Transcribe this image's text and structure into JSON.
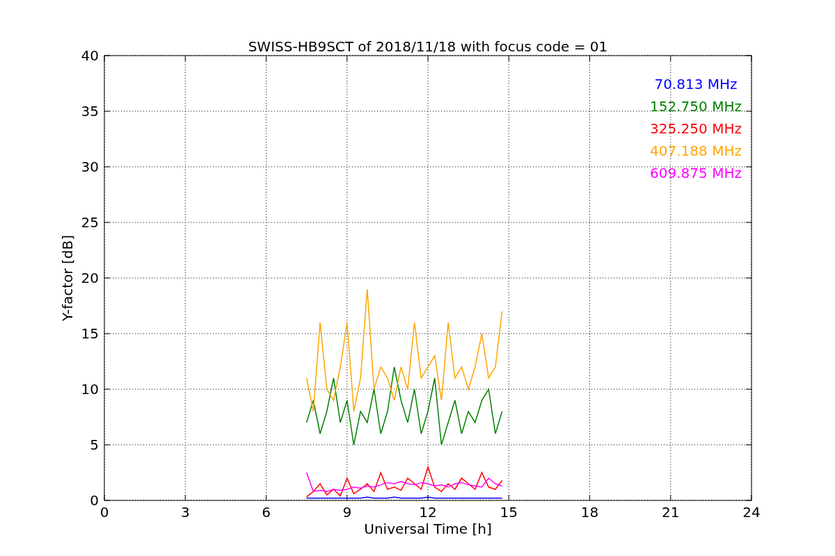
{
  "figure": {
    "chart_data": {
      "type": "line",
      "title": "SWISS-HB9SCT of 2018/11/18 with focus code = 01",
      "xlabel": "Universal Time [h]",
      "ylabel": "Y-factor [dB]",
      "x": [
        7.5,
        7.75,
        8,
        8.25,
        8.5,
        8.75,
        9,
        9.25,
        9.5,
        9.75,
        10,
        10.25,
        10.5,
        10.75,
        11,
        11.25,
        11.5,
        11.75,
        12,
        12.25,
        12.5,
        12.75,
        13,
        13.25,
        13.5,
        13.75,
        14,
        14.25,
        14.5,
        14.75
      ],
      "series": [
        {
          "name": "70.813 MHz",
          "color": "#0000ff",
          "values": [
            0.2,
            0.2,
            0.2,
            0.2,
            0.2,
            0.2,
            0.2,
            0.2,
            0.2,
            0.3,
            0.2,
            0.2,
            0.2,
            0.3,
            0.2,
            0.2,
            0.2,
            0.2,
            0.3,
            0.2,
            0.2,
            0.2,
            0.2,
            0.2,
            0.2,
            0.2,
            0.2,
            0.2,
            0.2,
            0.2
          ]
        },
        {
          "name": "152.750 MHz",
          "color": "#008000",
          "values": [
            7,
            9,
            6,
            8,
            11,
            7,
            9,
            5,
            8,
            7,
            10,
            6,
            8,
            12,
            9,
            7,
            10,
            6,
            8,
            11,
            5,
            7,
            9,
            6,
            8,
            7,
            9,
            10,
            6,
            8
          ]
        },
        {
          "name": "325.250 MHz",
          "color": "#ff0000",
          "values": [
            0.3,
            0.8,
            1.5,
            0.5,
            1,
            0.4,
            2,
            0.6,
            1,
            1.5,
            0.8,
            2.5,
            1,
            1.2,
            0.9,
            2,
            1.5,
            1,
            3,
            1.2,
            0.8,
            1.5,
            1,
            2,
            1.5,
            1,
            2.5,
            1.2,
            1,
            1.8
          ]
        },
        {
          "name": "407.188 MHz",
          "color": "#ffa500",
          "values": [
            11,
            8,
            16,
            10,
            9,
            12,
            16,
            8,
            11,
            19,
            10,
            12,
            11,
            9,
            12,
            10,
            16,
            11,
            12,
            13,
            9,
            16,
            11,
            12,
            10,
            12,
            15,
            11,
            12,
            17
          ]
        },
        {
          "name": "609.875 MHz",
          "color": "#ff00ff",
          "values": [
            2.5,
            0.8,
            0.9,
            0.8,
            1,
            0.9,
            1,
            1.2,
            1.1,
            1.3,
            1.2,
            1.4,
            1.6,
            1.5,
            1.7,
            1.5,
            1.4,
            1.6,
            1.5,
            1.3,
            1.4,
            1.2,
            1.5,
            1.6,
            1.4,
            1.3,
            1.2,
            2,
            1.5,
            1.3
          ]
        }
      ],
      "xlim": [
        0,
        24
      ],
      "ylim": [
        0,
        40
      ],
      "grid": true,
      "xticks": [
        0,
        3,
        6,
        9,
        12,
        15,
        18,
        21,
        24
      ],
      "yticks": [
        0,
        5,
        10,
        15,
        20,
        25,
        30,
        35,
        40
      ]
    }
  }
}
